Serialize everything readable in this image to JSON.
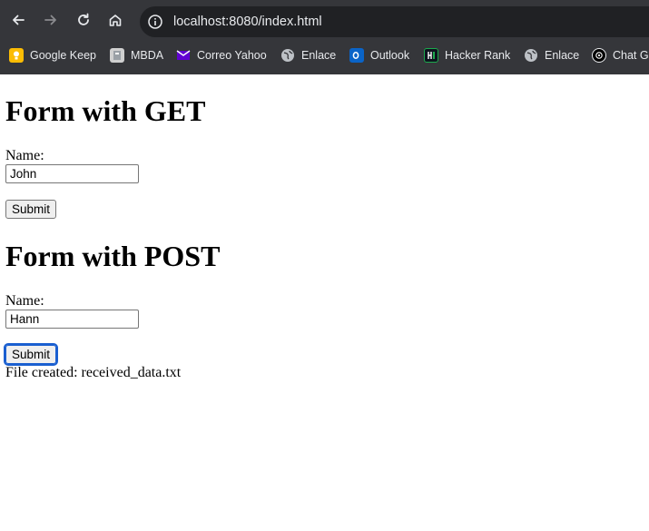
{
  "browser": {
    "url": "localhost:8080/index.html",
    "bookmarks": [
      {
        "label": "Google Keep",
        "icon": "google-keep-icon",
        "color": "#fbbc04"
      },
      {
        "label": "MBDA",
        "icon": "mbda-icon",
        "color": "#d0d0d0"
      },
      {
        "label": "Correo Yahoo",
        "icon": "yahoo-mail-icon",
        "color": "#6001d2"
      },
      {
        "label": "Enlace",
        "icon": "globe-icon",
        "color": "#bdc1c6"
      },
      {
        "label": "Outlook",
        "icon": "outlook-icon",
        "color": "#0a64c8"
      },
      {
        "label": "Hacker Rank",
        "icon": "hackerrank-icon",
        "color": "#1ba94c"
      },
      {
        "label": "Enlace",
        "icon": "globe-icon",
        "color": "#bdc1c6"
      },
      {
        "label": "Chat G",
        "icon": "chatgpt-icon",
        "color": "#ffffff"
      }
    ]
  },
  "get_form": {
    "title": "Form with GET",
    "name_label": "Name:",
    "name_value": "John",
    "submit_label": "Submit"
  },
  "post_form": {
    "title": "Form with POST",
    "name_label": "Name:",
    "name_value": "Hann",
    "submit_label": "Submit"
  },
  "status_message": "File created: received_data.txt"
}
